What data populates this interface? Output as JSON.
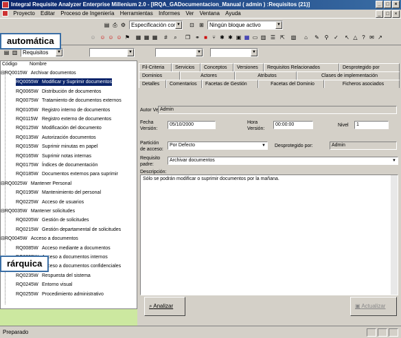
{
  "window": {
    "title": "Integral Requisite Analyzer Enterprise Millenium 2.0 - [IRQA_GADocumentacion_Manual ( admin ) :Requisitos (21)]"
  },
  "menu": [
    "Proyecto",
    "Editar",
    "Proceso de Ingeniería",
    "Herramientas",
    "Informes",
    "Ver",
    "Ventana",
    "Ayuda"
  ],
  "toolbar": {
    "spec_combo": "Especificación completa",
    "block_combo": "Ningún bloque activo",
    "view_combo": "Requisitos"
  },
  "callouts": {
    "top": "automática",
    "bottom": "rárquica"
  },
  "tree": {
    "col_code": "Código",
    "col_name": "Nombre",
    "rows": [
      {
        "code": "RQ0015W",
        "name": "Archivar documentos",
        "indent": 0,
        "toggle": "⊟"
      },
      {
        "code": "RQ0055W",
        "name": "Modificar y Suprimir documentos",
        "indent": 1,
        "toggle": "",
        "selected": true
      },
      {
        "code": "RQ0065W",
        "name": "Distribución de documentos",
        "indent": 1,
        "toggle": ""
      },
      {
        "code": "RQ0075W",
        "name": "Tratamiento de documentos externos",
        "indent": 1,
        "toggle": ""
      },
      {
        "code": "RQ0105W",
        "name": "Registro interno de documentos",
        "indent": 1,
        "toggle": ""
      },
      {
        "code": "RQ0115W",
        "name": "Registro externo de documentos",
        "indent": 1,
        "toggle": ""
      },
      {
        "code": "RQ0125W",
        "name": "Modificación del documento",
        "indent": 1,
        "toggle": ""
      },
      {
        "code": "RQ0135W",
        "name": "Autorización documentos",
        "indent": 1,
        "toggle": ""
      },
      {
        "code": "RQ0155W",
        "name": "Suprimir minutas en papel",
        "indent": 1,
        "toggle": ""
      },
      {
        "code": "RQ0165W",
        "name": "Suprimir notas internas",
        "indent": 1,
        "toggle": ""
      },
      {
        "code": "RQ0175W",
        "name": "Índices de documentación",
        "indent": 1,
        "toggle": ""
      },
      {
        "code": "RQ0185W",
        "name": "Documentos externos para suprimir",
        "indent": 1,
        "toggle": ""
      },
      {
        "code": "RQ0025W",
        "name": "Mantener Personal",
        "indent": 0,
        "toggle": "⊟"
      },
      {
        "code": "RQ0195W",
        "name": "Mantenimiento del personal",
        "indent": 1,
        "toggle": ""
      },
      {
        "code": "RQ0225W",
        "name": "Acceso de usuarios",
        "indent": 1,
        "toggle": ""
      },
      {
        "code": "RQ0035W",
        "name": "Mantener solicitudes",
        "indent": 0,
        "toggle": "⊟"
      },
      {
        "code": "RQ0205W",
        "name": "Gestión de solicitudes",
        "indent": 1,
        "toggle": ""
      },
      {
        "code": "RQ0215W",
        "name": "Gestión departamental de solicitudes",
        "indent": 1,
        "toggle": ""
      },
      {
        "code": "RQ0045W",
        "name": "Acceso a documentos",
        "indent": 0,
        "toggle": "⊟"
      },
      {
        "code": "RQ0085W",
        "name": "Acceso mediante a documentos",
        "indent": 1,
        "toggle": ""
      },
      {
        "code": "RQ0095W",
        "name": "Acceso a documentos internos",
        "indent": 1,
        "toggle": ""
      },
      {
        "code": "RQ0145W",
        "name": "Acceso a documentos confidenciales",
        "indent": 1,
        "toggle": ""
      },
      {
        "code": "RQ0235W",
        "name": "Respuesta del sistema",
        "indent": 1,
        "toggle": ""
      },
      {
        "code": "RQ0245W",
        "name": "Entorno visual",
        "indent": 1,
        "toggle": ""
      },
      {
        "code": "RQ0255W",
        "name": "Procedimiento administrativo",
        "indent": 1,
        "toggle": ""
      }
    ]
  },
  "tabs_row1": [
    "Fil-Criteria",
    "Servicios",
    "Conceptos",
    "Versiones",
    "Requisitos Relacionados",
    "Desprotegido por"
  ],
  "tabs_row2": [
    "Dominios",
    "Actores",
    "Atributos",
    "Clases de implementación"
  ],
  "tabs_row3": [
    "Detalles",
    "Comentarios",
    "Facetas de Gestión",
    "Facetas del Dominio",
    "Ficheros asociados"
  ],
  "details": {
    "autor_label": "Autor Versión:",
    "autor_value": "Admin",
    "fecha_label": "Fecha Versión:",
    "fecha_value": "05/10/2000",
    "hora_label": "Hora Versión:",
    "hora_value": "00:00:00",
    "nivel_label": "Nivel",
    "nivel_value": "1",
    "particion_label": "Partición de acceso:",
    "particion_value": "Por Defecto",
    "desprotegido_label": "Desprotegido por:",
    "desprotegido_value": "Admin",
    "padre_label": "Requisito padre:",
    "padre_value": "Archivar documentos",
    "descripcion_label": "Descripción:",
    "descripcion_value": "Sólo se podrán modificar o suprimir documentos por la mañana."
  },
  "buttons": {
    "analizar": "Analizar",
    "actualizar": "Actualizar"
  },
  "status": "Preparado"
}
